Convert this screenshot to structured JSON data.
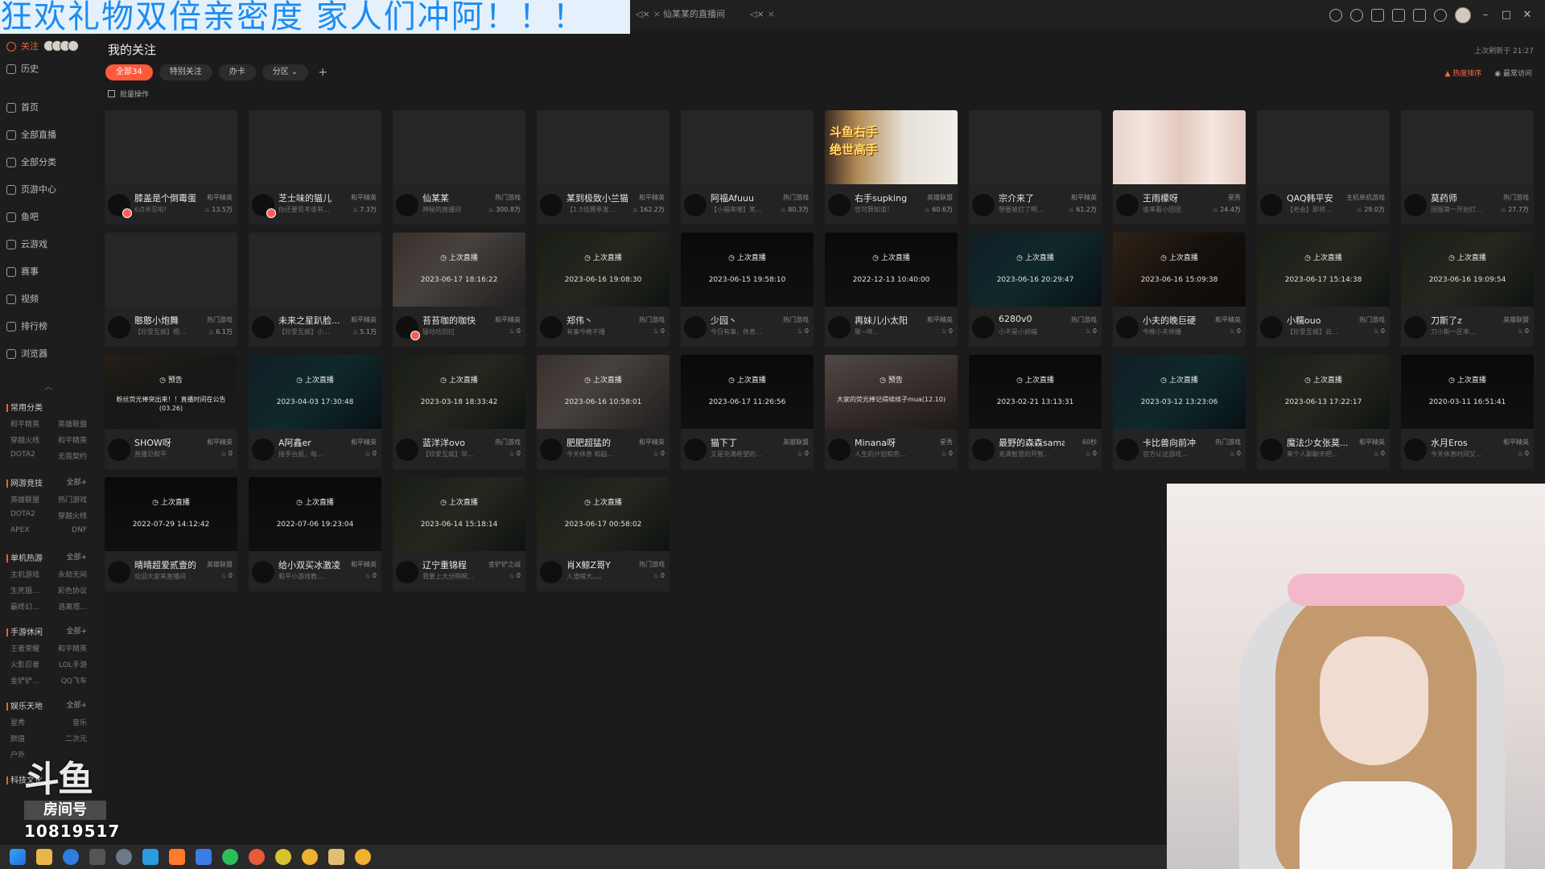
{
  "banner": {
    "text": "狂欢礼物双倍亲密度 家人们冲阿！！！"
  },
  "window": {
    "tabs": [
      {
        "label": "仙某某的直播间"
      }
    ]
  },
  "sidebar": {
    "follow_label": "关注",
    "items": [
      {
        "label": "历史",
        "icon": "clock-icon"
      },
      {
        "label": "首页",
        "icon": "home-icon"
      },
      {
        "label": "全部直播",
        "icon": "live-icon"
      },
      {
        "label": "全部分类",
        "icon": "grid-icon"
      },
      {
        "label": "页游中心",
        "icon": "gamepad-icon"
      },
      {
        "label": "鱼吧",
        "icon": "fish-icon"
      },
      {
        "label": "云游戏",
        "icon": "cloud-icon"
      },
      {
        "label": "赛事",
        "icon": "trophy-icon"
      },
      {
        "label": "视频",
        "icon": "video-icon"
      },
      {
        "label": "排行榜",
        "icon": "rank-icon"
      },
      {
        "label": "浏览器",
        "icon": "browser-icon"
      }
    ],
    "categories": [
      {
        "title": "常用分类",
        "more": "",
        "items": [
          "和平精英",
          "英雄联盟",
          "穿越火线",
          "和平精英",
          "DOTA2",
          "无畏契约"
        ]
      },
      {
        "title": "网游竞技",
        "more": "全部+",
        "items": [
          "英雄联盟",
          "热门游戏",
          "DOTA2",
          "穿越火线",
          "APEX",
          "DNF"
        ]
      },
      {
        "title": "单机热游",
        "more": "全部+",
        "items": [
          "主机游戏",
          "永劫无间",
          "生死狙...",
          "彩色协议",
          "最终幻...",
          "逃离塔..."
        ]
      },
      {
        "title": "手游休闲",
        "more": "全部+",
        "items": [
          "王者荣耀",
          "和平精英",
          "火影忍者",
          "LOL手游",
          "金铲铲...",
          "QQ飞车"
        ]
      },
      {
        "title": "娱乐天地",
        "more": "全部+",
        "items": [
          "星秀",
          "音乐",
          "颜值",
          "二次元",
          "户外",
          ""
        ]
      },
      {
        "title": "科技文化",
        "more": "",
        "items": []
      }
    ]
  },
  "watermark": {
    "logo": "斗鱼",
    "room_label": "房间号",
    "room_number": "10819517"
  },
  "main": {
    "title": "我的关注",
    "last_refresh": "上次刷新于 21:27",
    "filters": [
      {
        "label": "全部34",
        "active": true
      },
      {
        "label": "特别关注",
        "active": false
      },
      {
        "label": "办卡",
        "active": false
      },
      {
        "label": "分区 ⌄",
        "active": false
      }
    ],
    "add_label": "+",
    "sort_hot": "热度排序",
    "sort_recent": "最常访问",
    "batch_label": "批量操作"
  },
  "cards": [
    {
      "name": "膝盖是个倒霉蛋",
      "cat": "和平精英",
      "desc": "6点半见啦!",
      "heat": "13.5万",
      "thumb": "blank",
      "badge": "",
      "time": "",
      "lv": true
    },
    {
      "name": "芝士味的猫儿",
      "cat": "和平精英",
      "desc": "你还要思考谁有...",
      "heat": "7.3万",
      "thumb": "blank",
      "badge": "",
      "time": "",
      "lv": true
    },
    {
      "name": "仙某某",
      "cat": "热门游戏",
      "desc": "神秘的直播间",
      "heat": "300.8万",
      "thumb": "blank",
      "badge": "",
      "time": "",
      "lv": false
    },
    {
      "name": "某到极致小兰猫",
      "cat": "和平精英",
      "desc": "【1.5倍赛季发...",
      "heat": "162.2万",
      "thumb": "blank",
      "badge": "",
      "time": "",
      "lv": false
    },
    {
      "name": "阿福Afuuu",
      "cat": "热门游戏",
      "desc": "【小福来喽】笑...",
      "heat": "80.3万",
      "thumb": "blank",
      "badge": "",
      "time": "",
      "lv": false
    },
    {
      "name": "右手supking",
      "cat": "英雄联盟",
      "desc": "世可算知道！",
      "heat": "60.6万",
      "thumb": "live-img jp",
      "badge": "",
      "time": "",
      "lv": false
    },
    {
      "name": "宗介来了",
      "cat": "和平精英",
      "desc": "想要被打了啊...",
      "heat": "61.2万",
      "thumb": "blank",
      "badge": "",
      "time": "",
      "lv": false
    },
    {
      "name": "王雨檬呀",
      "cat": "星秀",
      "desc": "谁来看小团团",
      "heat": "24.4万",
      "thumb": "live-img gl",
      "badge": "",
      "time": "",
      "lv": false
    },
    {
      "name": "QAQ韩平安",
      "cat": "主机单机游戏",
      "desc": "【老会】即将...",
      "heat": "29.0万",
      "thumb": "blank",
      "badge": "",
      "time": "",
      "lv": false
    },
    {
      "name": "莫药师",
      "cat": "热门游戏",
      "desc": "国服第一开始打...",
      "heat": "27.7万",
      "thumb": "blank",
      "badge": "",
      "time": "",
      "lv": false
    },
    {
      "name": "憨憨小炮舞",
      "cat": "热门游戏",
      "desc": "【珍爱互娱】相...",
      "heat": "6.1万",
      "thumb": "blank",
      "badge": "",
      "time": "",
      "lv": false
    },
    {
      "name": "未来之星趴脸...",
      "cat": "和平精英",
      "desc": "【珍爱互娱】小...",
      "heat": "5.1万",
      "thumb": "blank",
      "badge": "",
      "time": "",
      "lv": false
    },
    {
      "name": "苔苔咖的咖快",
      "cat": "和平精英",
      "desc": "猛咕咕别拉",
      "heat": "0",
      "thumb": "scene-c",
      "badge": "上次直播",
      "time": "2023-06-17 18:16:22",
      "lv": true
    },
    {
      "name": "郑伟丶",
      "cat": "热门游戏",
      "desc": "有事今晚不播",
      "heat": "0",
      "thumb": "scene-b",
      "badge": "上次直播",
      "time": "2023-06-16 19:08:30",
      "lv": false
    },
    {
      "name": "少园丶",
      "cat": "热门游戏",
      "desc": "今日有事，休息...",
      "heat": "0",
      "thumb": "dark",
      "badge": "上次直播",
      "time": "2023-06-15 19:58:10",
      "lv": false
    },
    {
      "name": "再妹儿小太阳",
      "cat": "和平精英",
      "desc": "聚~咩...",
      "heat": "0",
      "thumb": "dark",
      "badge": "上次直播",
      "time": "2022-12-13 10:40:00",
      "lv": false
    },
    {
      "name": "6280v0",
      "cat": "热门游戏",
      "desc": "小不是小娇喵",
      "heat": "0",
      "thumb": "scene-d",
      "badge": "上次直播",
      "time": "2023-06-16 20:29:47",
      "lv": false
    },
    {
      "name": "小夫的晚巨硬",
      "cat": "和平精英",
      "desc": "今晚小夫停播",
      "heat": "0",
      "thumb": "scene-e",
      "badge": "上次直播",
      "time": "2023-06-16 15:09:38",
      "lv": false
    },
    {
      "name": "小糯ouo",
      "cat": "热门游戏",
      "desc": "【珍爱互娱】云...",
      "heat": "0",
      "thumb": "scene-b",
      "badge": "上次直播",
      "time": "2023-06-17 15:14:38",
      "lv": false
    },
    {
      "name": "刀斯了z",
      "cat": "英雄联盟",
      "desc": "刀小斯一区率...",
      "heat": "0",
      "thumb": "scene-b",
      "badge": "上次直播",
      "time": "2023-06-16 19:09:54",
      "lv": false
    },
    {
      "name": "SHOW呀",
      "cat": "和平精英",
      "desc": "直播见和平",
      "heat": "0",
      "thumb": "scene-a",
      "badge": "预告",
      "time": "",
      "notice": "粉丝荧光棒突出来！！直播时间在公告(03.26)",
      "lv": false
    },
    {
      "name": "A阿鑫er",
      "cat": "和平精英",
      "desc": "接手台报，每...",
      "heat": "0",
      "thumb": "scene-d",
      "badge": "上次直播",
      "time": "2023-04-03 17:30:48",
      "lv": false
    },
    {
      "name": "蓝洋洋ovo",
      "cat": "热门游戏",
      "desc": "【珍爱互娱】早...",
      "heat": "0",
      "thumb": "scene-b",
      "badge": "上次直播",
      "time": "2023-03-18 18:33:42",
      "lv": false
    },
    {
      "name": "肥肥超猛的",
      "cat": "和平精英",
      "desc": "今天休息 和超...",
      "heat": "0",
      "thumb": "scene-c",
      "badge": "上次直播",
      "time": "2023-06-16 10:58:01",
      "lv": false
    },
    {
      "name": "猫下丁",
      "cat": "英雄联盟",
      "desc": "又是充满希望的...",
      "heat": "0",
      "thumb": "dark",
      "badge": "上次直播",
      "time": "2023-06-17 11:26:56",
      "lv": false
    },
    {
      "name": "Minana呀",
      "cat": "星秀",
      "desc": "人生的计划和完...",
      "heat": "0",
      "thumb": "scene-f",
      "badge": "预告",
      "time": "",
      "notice": "大家的荧光棒记得续续子mua(12.10)",
      "lv": false
    },
    {
      "name": "最野的森森sama",
      "cat": "60秒",
      "desc": "充满智慧的开智...",
      "heat": "0",
      "thumb": "dark",
      "badge": "上次直播",
      "time": "2023-02-21 13:13:31",
      "lv": false
    },
    {
      "name": "卡比兽向前冲",
      "cat": "热门游戏",
      "desc": "官方认证游戏...",
      "heat": "0",
      "thumb": "scene-d",
      "badge": "上次直播",
      "time": "2023-03-12 13:23:06",
      "lv": false
    },
    {
      "name": "魔法少女张莫...",
      "cat": "和平精英",
      "desc": "来个人聊聊天吧...",
      "heat": "0",
      "thumb": "scene-b",
      "badge": "上次直播",
      "time": "2023-06-13 17:22:17",
      "lv": false
    },
    {
      "name": "水月Eros",
      "cat": "和平精英",
      "desc": "今天休息时间又...",
      "heat": "0",
      "thumb": "dark",
      "badge": "上次直播",
      "time": "2020-03-11 16:51:41",
      "lv": false
    },
    {
      "name": "晴晴超爱贰壹的",
      "cat": "英雄联盟",
      "desc": "欢迎大家来直播间",
      "heat": "0",
      "thumb": "dark",
      "badge": "上次直播",
      "time": "2022-07-29 14:12:42",
      "lv": false
    },
    {
      "name": "给小双买冰激凌",
      "cat": "和平精英",
      "desc": "和平小游戏教...",
      "heat": "0",
      "thumb": "dark",
      "badge": "上次直播",
      "time": "2022-07-06 19:23:04",
      "lv": false
    },
    {
      "name": "辽宁重锦程",
      "cat": "金铲铲之战",
      "desc": "我要上大分啊啊...",
      "heat": "0",
      "thumb": "scene-b",
      "badge": "上次直播",
      "time": "2023-06-14 15:18:14",
      "lv": false
    },
    {
      "name": "肖X鲸Z哥Y",
      "cat": "热门游戏",
      "desc": "人渣喊大。。。",
      "heat": "0",
      "thumb": "scene-b",
      "badge": "上次直播",
      "time": "2023-06-17 00:58:02",
      "lv": false
    }
  ]
}
